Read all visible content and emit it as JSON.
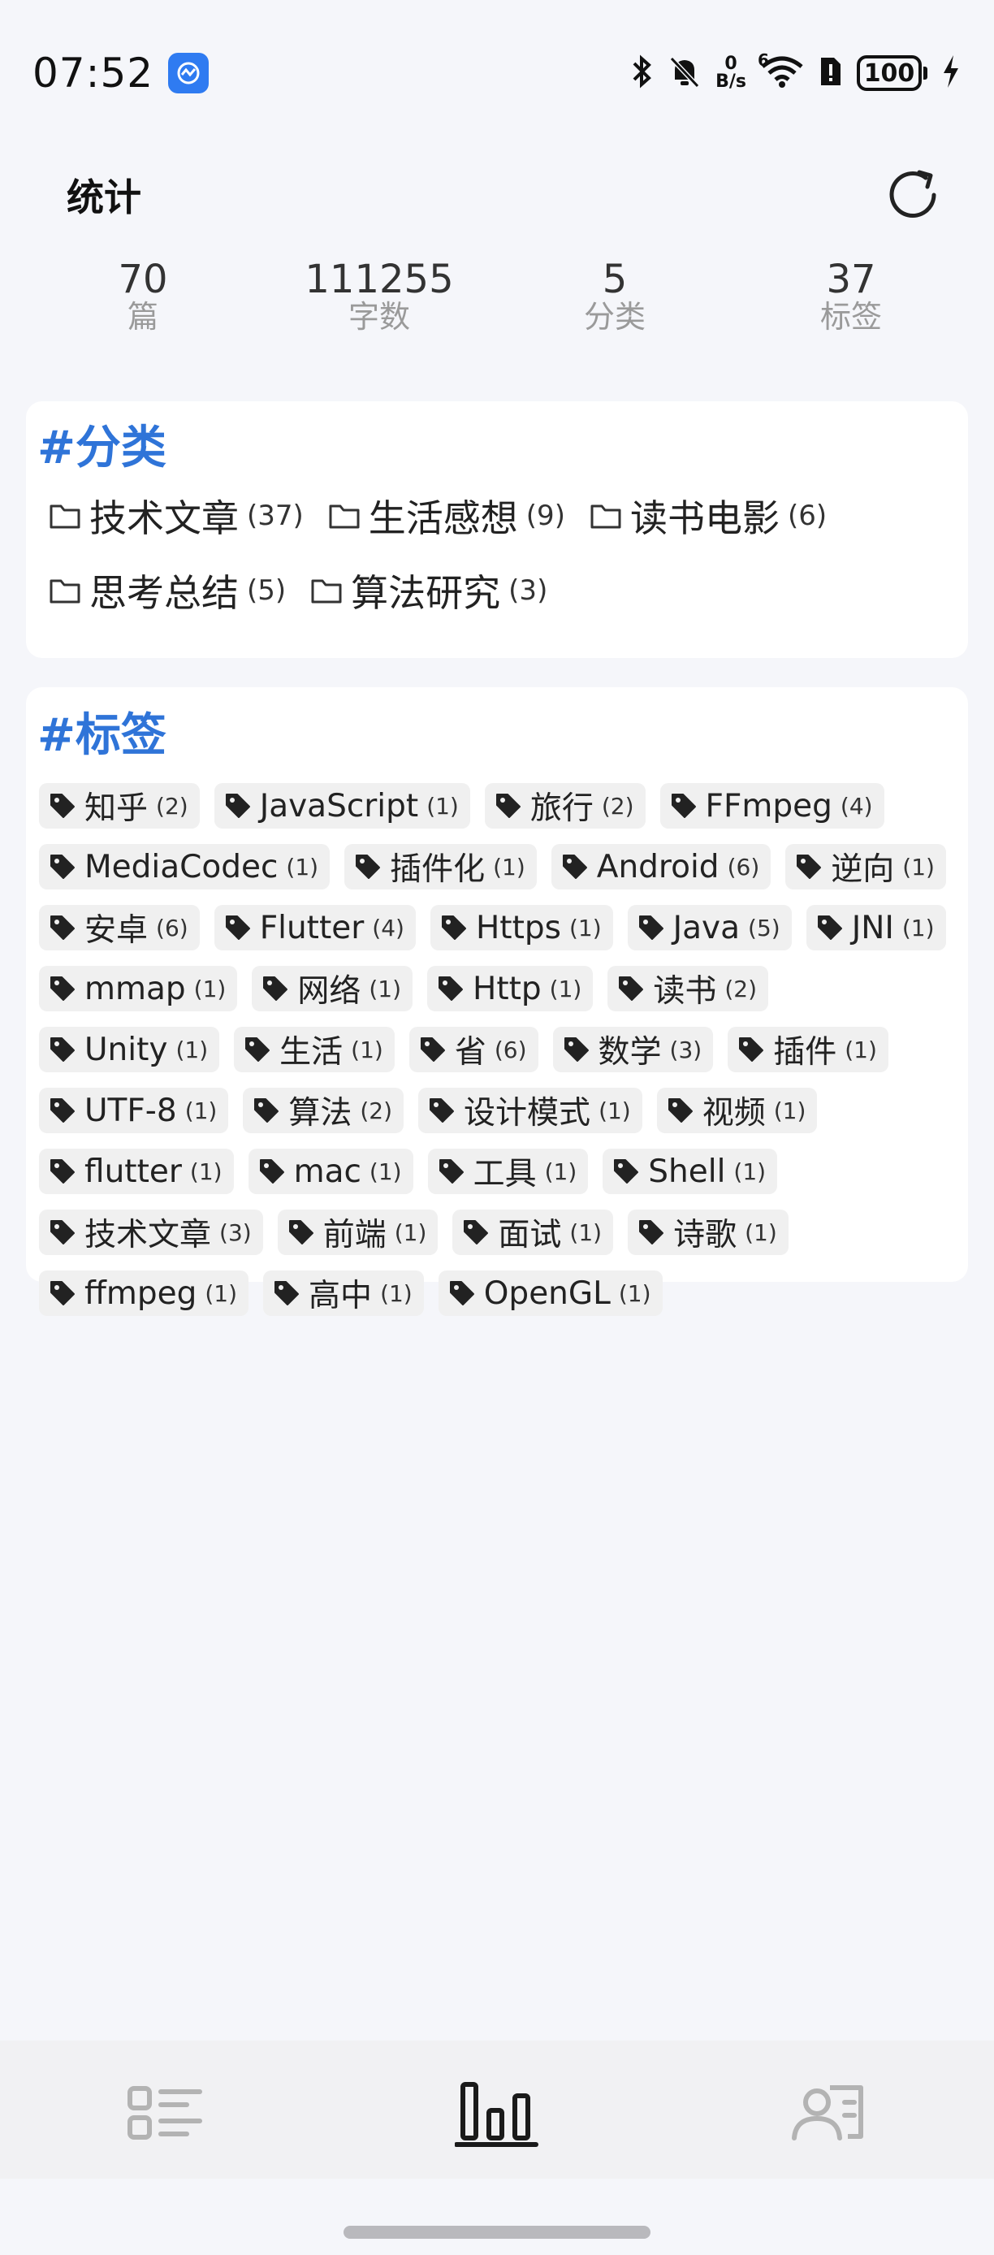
{
  "status_bar": {
    "time": "07:52",
    "net_speed_value": "0",
    "net_speed_unit": "B/s",
    "wifi_superscript": "6",
    "battery": "100",
    "icons": [
      "app-notification-icon",
      "bluetooth-icon",
      "mute-bell-icon",
      "wifi-icon",
      "sim-alert-icon",
      "battery-icon",
      "charging-bolt-icon"
    ]
  },
  "header": {
    "title": "统计",
    "refresh_icon": "refresh-icon"
  },
  "stats": [
    {
      "value": "70",
      "label": "篇"
    },
    {
      "value": "111255",
      "label": "字数"
    },
    {
      "value": "5",
      "label": "分类"
    },
    {
      "value": "37",
      "label": "标签"
    }
  ],
  "categories": {
    "title": "#分类",
    "items": [
      {
        "name": "技术文章",
        "count": "(37)"
      },
      {
        "name": "生活感想",
        "count": "(9)"
      },
      {
        "name": "读书电影",
        "count": "(6)"
      },
      {
        "name": "思考总结",
        "count": "(5)"
      },
      {
        "name": "算法研究",
        "count": "(3)"
      }
    ]
  },
  "tags": {
    "title": "#标签",
    "items": [
      {
        "name": "知乎",
        "count": "(2)"
      },
      {
        "name": "JavaScript",
        "count": "(1)"
      },
      {
        "name": "旅行",
        "count": "(2)"
      },
      {
        "name": "FFmpeg",
        "count": "(4)"
      },
      {
        "name": "MediaCodec",
        "count": "(1)"
      },
      {
        "name": "插件化",
        "count": "(1)"
      },
      {
        "name": "Android",
        "count": "(6)"
      },
      {
        "name": "逆向",
        "count": "(1)"
      },
      {
        "name": "安卓",
        "count": "(6)"
      },
      {
        "name": "Flutter",
        "count": "(4)"
      },
      {
        "name": "Https",
        "count": "(1)"
      },
      {
        "name": "Java",
        "count": "(5)"
      },
      {
        "name": "JNI",
        "count": "(1)"
      },
      {
        "name": "mmap",
        "count": "(1)"
      },
      {
        "name": "网络",
        "count": "(1)"
      },
      {
        "name": "Http",
        "count": "(1)"
      },
      {
        "name": "读书",
        "count": "(2)"
      },
      {
        "name": "Unity",
        "count": "(1)"
      },
      {
        "name": "生活",
        "count": "(1)"
      },
      {
        "name": "省",
        "count": "(6)"
      },
      {
        "name": "数学",
        "count": "(3)"
      },
      {
        "name": "插件",
        "count": "(1)"
      },
      {
        "name": "UTF-8",
        "count": "(1)"
      },
      {
        "name": "算法",
        "count": "(2)"
      },
      {
        "name": "设计模式",
        "count": "(1)"
      },
      {
        "name": "视频",
        "count": "(1)"
      },
      {
        "name": "flutter",
        "count": "(1)"
      },
      {
        "name": "mac",
        "count": "(1)"
      },
      {
        "name": "工具",
        "count": "(1)"
      },
      {
        "name": "Shell",
        "count": "(1)"
      },
      {
        "name": "技术文章",
        "count": "(3)"
      },
      {
        "name": "前端",
        "count": "(1)"
      },
      {
        "name": "面试",
        "count": "(1)"
      },
      {
        "name": "诗歌",
        "count": "(1)"
      },
      {
        "name": "ffmpeg",
        "count": "(1)"
      },
      {
        "name": "高中",
        "count": "(1)"
      },
      {
        "name": "OpenGL",
        "count": "(1)"
      }
    ]
  },
  "bottom_nav": {
    "items": [
      {
        "icon": "list-icon",
        "active": false
      },
      {
        "icon": "bar-chart-icon",
        "active": true
      },
      {
        "icon": "profile-card-icon",
        "active": false
      }
    ],
    "colors": {
      "active": "#1a1a1a",
      "inactive": "#b3b3b3"
    }
  },
  "colors": {
    "accent": "#2f74d8",
    "background": "#f5f6fa",
    "card": "#ffffff",
    "tag_bg": "#f0f0f0"
  }
}
